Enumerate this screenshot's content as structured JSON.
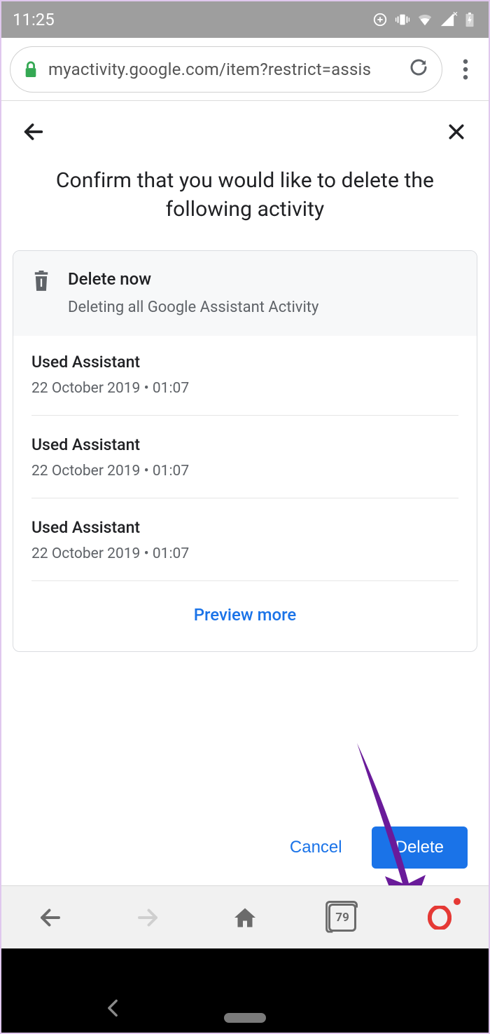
{
  "statusbar": {
    "time": "11:25"
  },
  "chrome": {
    "url": "myactivity.google.com/item?restrict=assis"
  },
  "page": {
    "title": "Confirm that you would like to delete the following activity",
    "card": {
      "header_title": "Delete now",
      "header_sub": "Deleting all Google Assistant Activity"
    },
    "entries": [
      {
        "title": "Used Assistant",
        "sub": "22 October 2019 • 01:07"
      },
      {
        "title": "Used Assistant",
        "sub": "22 October 2019 • 01:07"
      },
      {
        "title": "Used Assistant",
        "sub": "22 October 2019 • 01:07"
      }
    ],
    "preview_more": "Preview more",
    "cancel": "Cancel",
    "delete": "Delete"
  },
  "opera": {
    "tab_count": "79"
  }
}
